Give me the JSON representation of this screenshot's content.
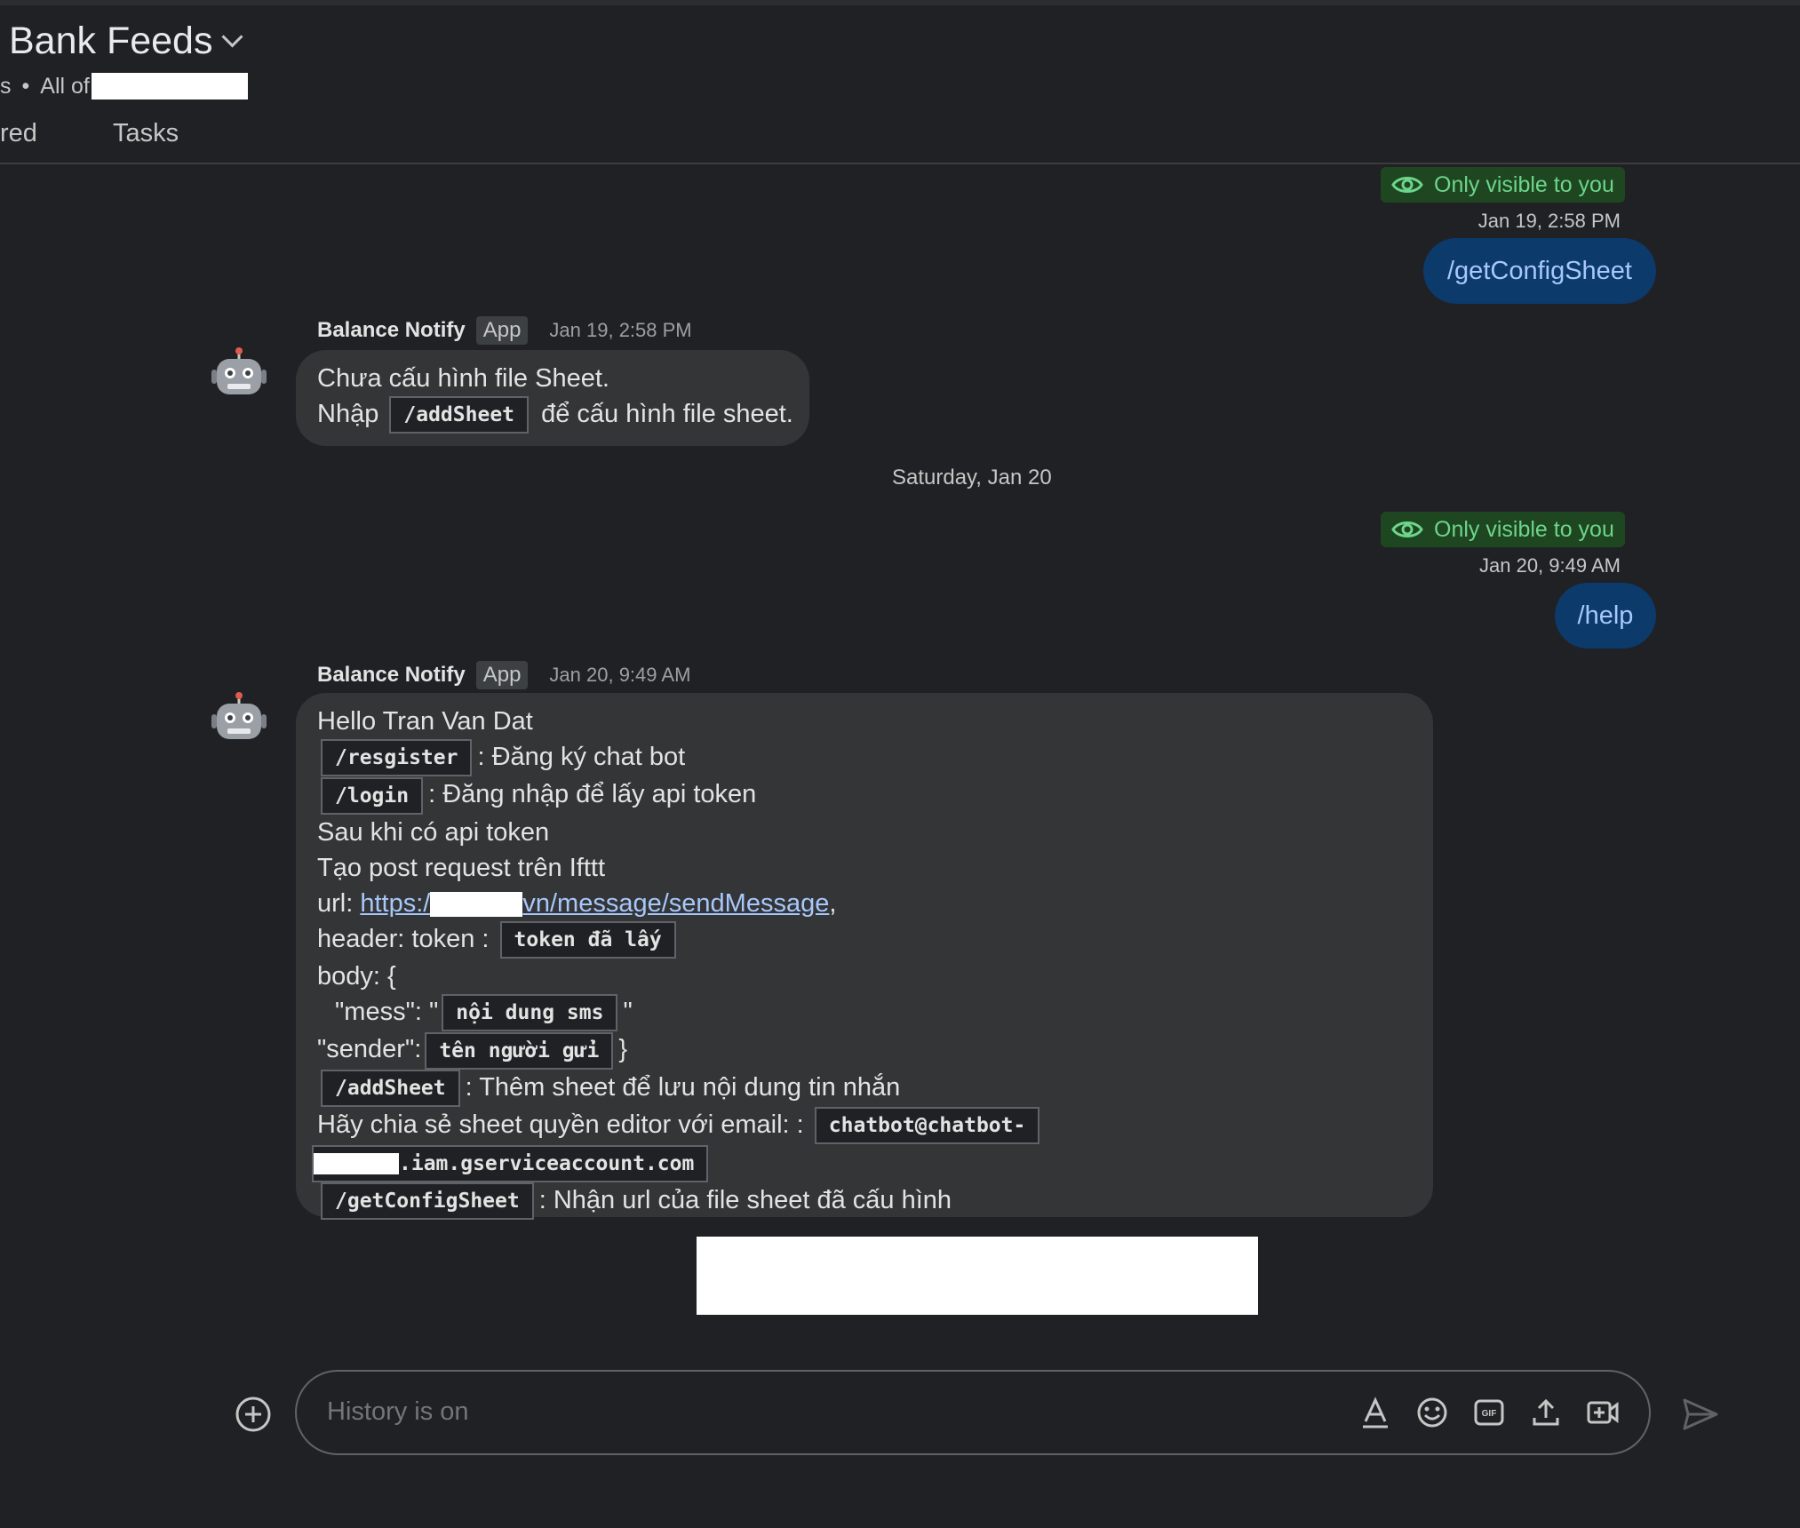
{
  "header": {
    "title": "Bank Feeds",
    "sub_prefix": "s",
    "sub_all_of": "All of",
    "tabs": [
      "red",
      "Tasks"
    ]
  },
  "messages": {
    "m1": {
      "visibility": "Only visible to you",
      "timestamp": "Jan 19, 2:58 PM",
      "text": "/getConfigSheet"
    },
    "m2": {
      "sender": "Balance Notify",
      "app_tag": "App",
      "timestamp": "Jan 19, 2:58 PM",
      "line1": "Chưa cấu hình file Sheet.",
      "line2_pre": "Nhập",
      "line2_code": "/addSheet",
      "line2_post": "để cấu hình file sheet."
    },
    "day_divider": "Saturday, Jan 20",
    "m3": {
      "visibility": "Only visible to you",
      "timestamp": "Jan 20, 9:49 AM",
      "text": "/help"
    },
    "m4": {
      "sender": "Balance Notify",
      "app_tag": "App",
      "timestamp": "Jan 20, 9:49 AM",
      "greeting": "Hello Tran Van Dat",
      "register_code": "/resgister",
      "register_text": ": Đăng ký chat bot",
      "login_code": "/login",
      "login_text": ": Đăng nhập để lấy api token",
      "after_token": "Sau khi có api token",
      "create_post": "Tạo post request trên Ifttt",
      "url_label": "url:",
      "url_start": "https:/",
      "url_end": "vn/message/sendMessage",
      "url_comma": ",",
      "header_label": "header: token :",
      "header_code": "token đã lấy",
      "body_open": "body: {",
      "mess_label": "\"mess\": \"",
      "mess_code": "nội dung sms",
      "mess_close": "\"",
      "sender_label": "\"sender\":",
      "sender_code": "tên người gửi",
      "body_close": "}",
      "addsheet_code": "/addSheet",
      "addsheet_text": ": Thêm sheet để lưu nội dung tin nhắn",
      "share_text": "Hãy chia sẻ sheet quyền editor với email: :",
      "email_code_1": "chatbot@chatbot-",
      "email_code_2": ".iam.gserviceaccount.com",
      "getconfig_code": "/getConfigSheet",
      "getconfig_text": ": Nhận url của file sheet đã cấu hình"
    }
  },
  "composer": {
    "placeholder": "History is on"
  },
  "icons": [
    "add-circle-icon",
    "format-text-icon",
    "emoji-icon",
    "gif-icon",
    "upload-icon",
    "video-add-icon",
    "send-icon",
    "eye-icon",
    "robot-avatar-icon",
    "chevron-down-icon"
  ],
  "colors": {
    "background": "#202124",
    "bubble_bot": "#333537",
    "bubble_own": "#0b3a6b",
    "own_text": "#a8c7fa",
    "visibility_bg": "#1e4620",
    "visibility_text": "#6dd58c"
  }
}
